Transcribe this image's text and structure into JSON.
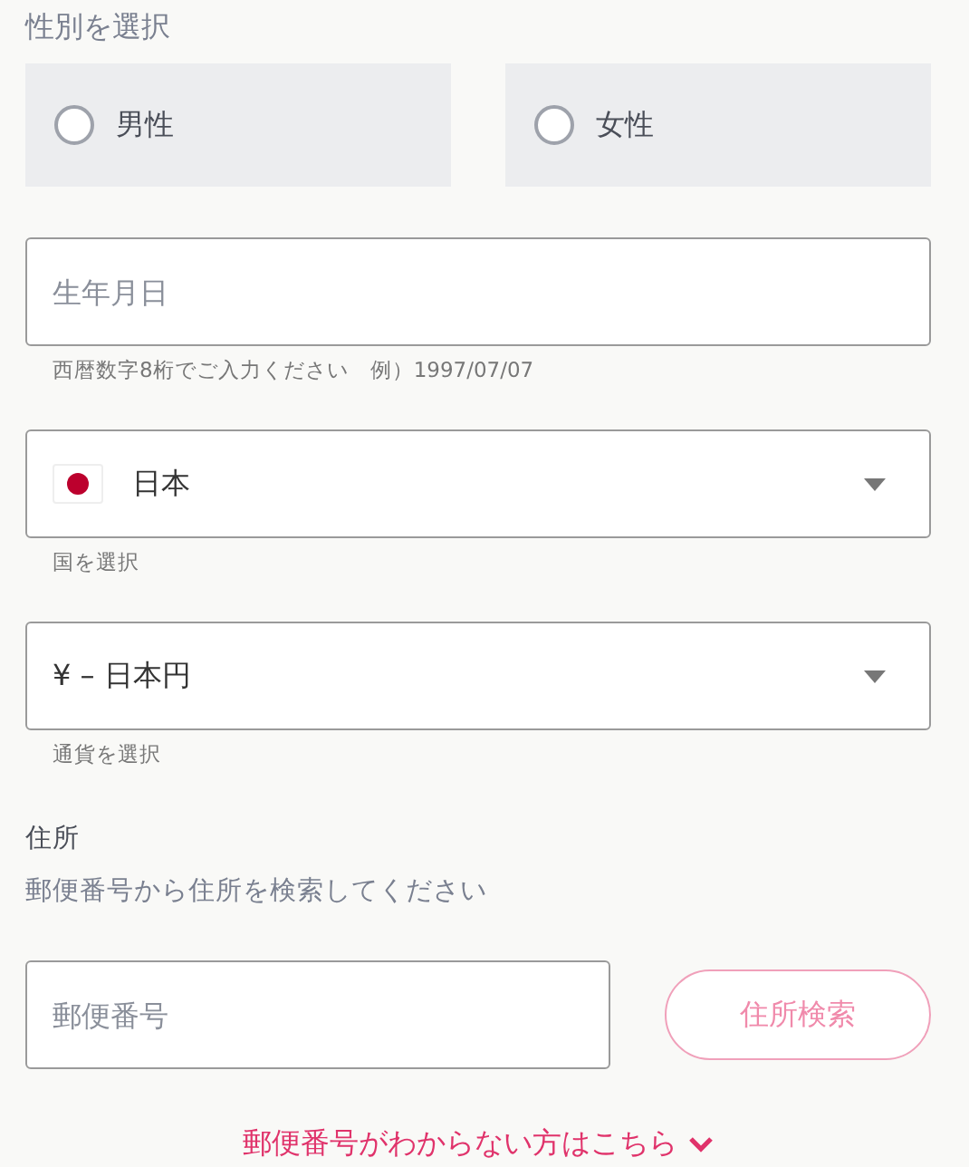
{
  "gender": {
    "label": "性別を選択",
    "options": [
      {
        "label": "男性",
        "selected": false
      },
      {
        "label": "女性",
        "selected": false
      }
    ]
  },
  "birthday": {
    "placeholder": "生年月日",
    "hint": "西暦数字8桁でご入力ください　例）1997/07/07"
  },
  "country": {
    "value": "日本",
    "hint": "国を選択"
  },
  "currency": {
    "value": "¥ – 日本円",
    "hint": "通貨を選択"
  },
  "address": {
    "label": "住所",
    "description": "郵便番号から住所を検索してください",
    "postal_placeholder": "郵便番号",
    "search_button": {
      "label": "住所検索",
      "disabled": true
    },
    "help_link": "郵便番号がわからない方はこちら"
  }
}
